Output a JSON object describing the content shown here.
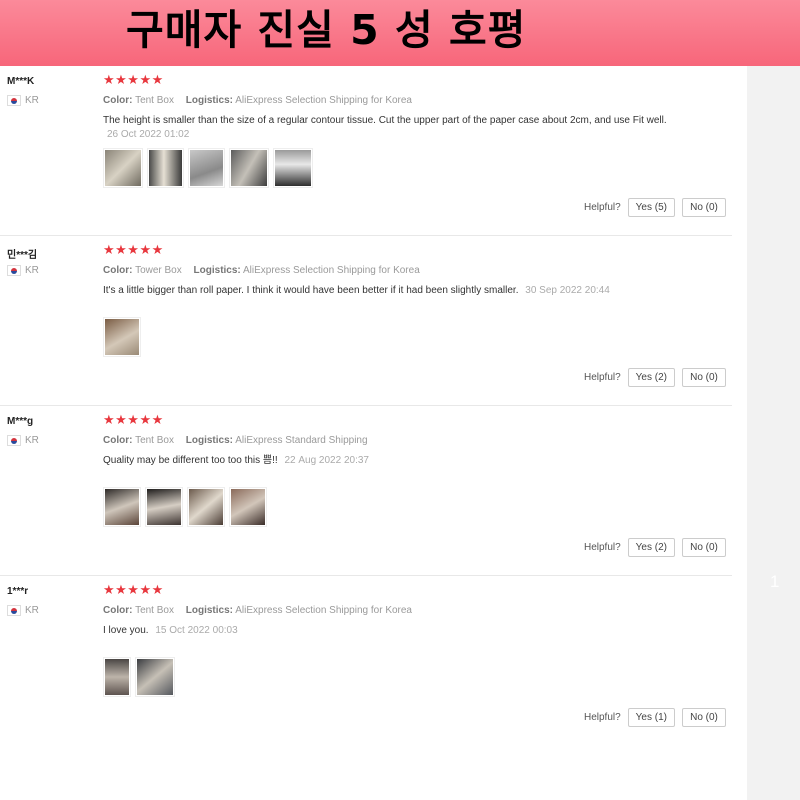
{
  "banner": {
    "title": "구매자 진실 5 성 호평"
  },
  "pager": {
    "current": "1"
  },
  "helpful_label": "Helpful?",
  "labels": {
    "color": "Color:",
    "logistics": "Logistics:"
  },
  "reviews": [
    {
      "user": "M***K",
      "country": "KR",
      "stars": "★★★★★",
      "color": "Tent Box",
      "logistics": "AliExpress Selection Shipping for Korea",
      "text": "The height is smaller than the size of a regular contour tissue. Cut the upper part of the paper case about 2cm, and use Fit well.",
      "date": "26 Oct 2022 01:02",
      "yes": "Yes (5)",
      "no": "No (0)"
    },
    {
      "user": "민***김",
      "country": "KR",
      "stars": "★★★★★",
      "color": "Tower Box",
      "logistics": "AliExpress Selection Shipping for Korea",
      "text": "It's a little bigger than roll paper. I think it would have been better if it had been slightly smaller.",
      "date": "30 Sep 2022 20:44",
      "yes": "Yes (2)",
      "no": "No (0)"
    },
    {
      "user": "M***g",
      "country": "KR",
      "stars": "★★★★★",
      "color": "Tent Box",
      "logistics": "AliExpress Standard Shipping",
      "text": "Quality may be different too too this 쁨!!",
      "date": "22 Aug 2022 20:37",
      "yes": "Yes (2)",
      "no": "No (0)"
    },
    {
      "user": "1***r",
      "country": "KR",
      "stars": "★★★★★",
      "color": "Tent Box",
      "logistics": "AliExpress Selection Shipping for Korea",
      "text": "I love you.",
      "date": "15 Oct 2022 00:03",
      "yes": "Yes (1)",
      "no": "No (0)"
    }
  ]
}
